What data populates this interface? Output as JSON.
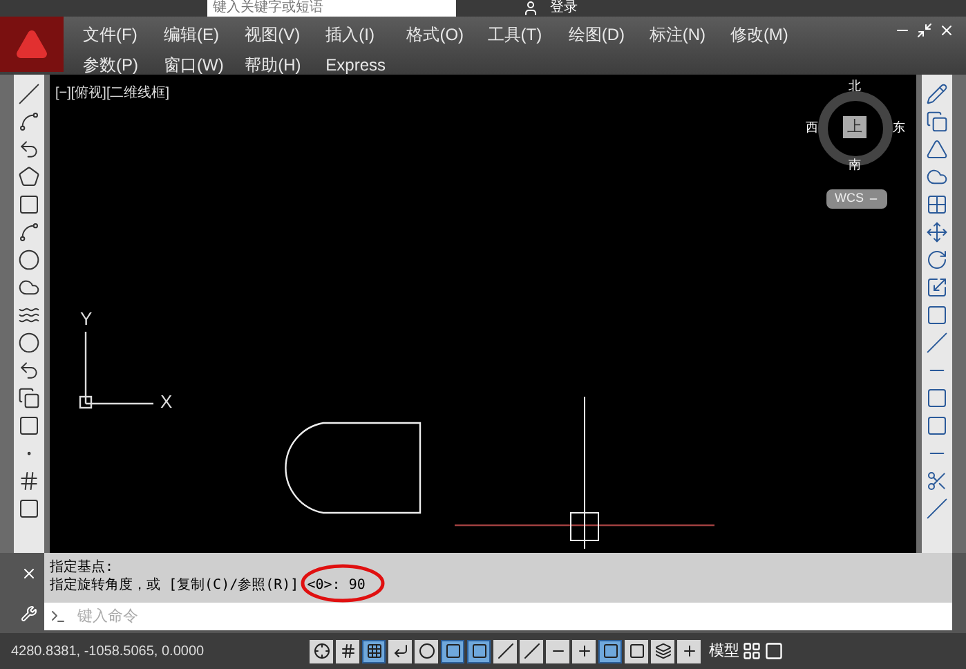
{
  "title_bar": {
    "search_placeholder": "键入关键字或短语",
    "login": "登录"
  },
  "menu": [
    {
      "label": "文件(F)"
    },
    {
      "label": "编辑(E)"
    },
    {
      "label": "视图(V)"
    },
    {
      "label": "插入(I)"
    },
    {
      "label": "格式(O)"
    },
    {
      "label": "工具(T)"
    },
    {
      "label": "绘图(D)"
    },
    {
      "label": "标注(N)"
    },
    {
      "label": "修改(M)"
    },
    {
      "label": "参数(P)"
    },
    {
      "label": "窗口(W)"
    },
    {
      "label": "帮助(H)"
    },
    {
      "label": "Express"
    }
  ],
  "viewport": {
    "label": "[−][俯视][二维线框]",
    "axis_x": "X",
    "axis_y": "Y",
    "compass": {
      "north": "北",
      "south": "南",
      "east": "东",
      "west": "西",
      "top": "上"
    },
    "wcs": "WCS"
  },
  "command": {
    "history": [
      "指定基点:",
      "指定旋转角度，或 [复制(C)/参照(R)] <0>:  90"
    ],
    "placeholder": "键入命令"
  },
  "status": {
    "coords": "4280.8381, -1058.5065, 0.0000",
    "model": "模型",
    "toggles": [
      {
        "on": false
      },
      {
        "on": false
      },
      {
        "on": true
      },
      {
        "on": false
      },
      {
        "on": false
      },
      {
        "on": true
      },
      {
        "on": true
      },
      {
        "on": false
      },
      {
        "on": false
      },
      {
        "on": false
      },
      {
        "on": false
      },
      {
        "on": true
      },
      {
        "on": false
      },
      {
        "on": false
      },
      {
        "on": false
      }
    ]
  }
}
